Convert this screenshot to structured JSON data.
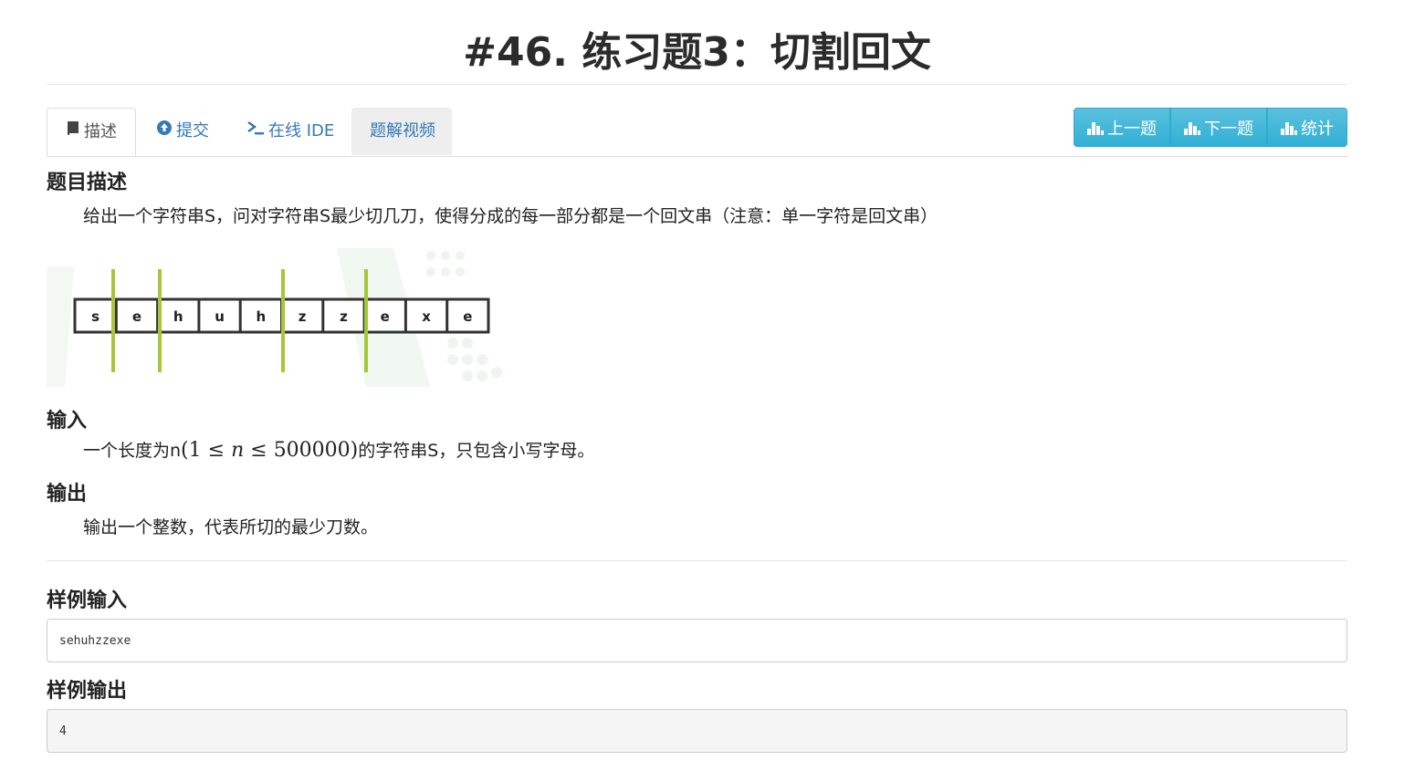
{
  "problem": {
    "title": "#46. 练习题3：切割回文"
  },
  "tabs": [
    {
      "label": "描述",
      "icon": "book-icon"
    },
    {
      "label": "提交",
      "icon": "upload-circle-icon"
    },
    {
      "label": "在线 IDE",
      "icon": "terminal-icon"
    },
    {
      "label": "题解视频"
    }
  ],
  "nav_buttons": {
    "prev": "上一题",
    "next": "下一题",
    "stats": "统计"
  },
  "description": {
    "heading": "题目描述",
    "text": "给出一个字符串S，问对字符串S最少切几刀，使得分成的每一部分都是一个回文串（注意：单一字符是回文串）"
  },
  "figure": {
    "letters": [
      "s",
      "e",
      "h",
      "u",
      "h",
      "z",
      "z",
      "e",
      "x",
      "e"
    ],
    "cut_color": "#a7c73a"
  },
  "input": {
    "heading": "输入",
    "text_before": "一个长度为n",
    "math_open": "(",
    "math_one": "1",
    "math_le": "≤",
    "math_n": "n",
    "math_max": "500000",
    "math_close": ")",
    "text_after": "的字符串S，只包含小写字母。"
  },
  "output": {
    "heading": "输出",
    "text": "输出一个整数，代表所切的最少刀数。"
  },
  "sample_input": {
    "heading": "样例输入",
    "value": "sehuhzzexe"
  },
  "sample_output": {
    "heading": "样例输出",
    "value": "4"
  },
  "colors": {
    "link": "#337ab7",
    "button": "#31b0d5",
    "sample_output_bg": "#f5f5f5"
  }
}
